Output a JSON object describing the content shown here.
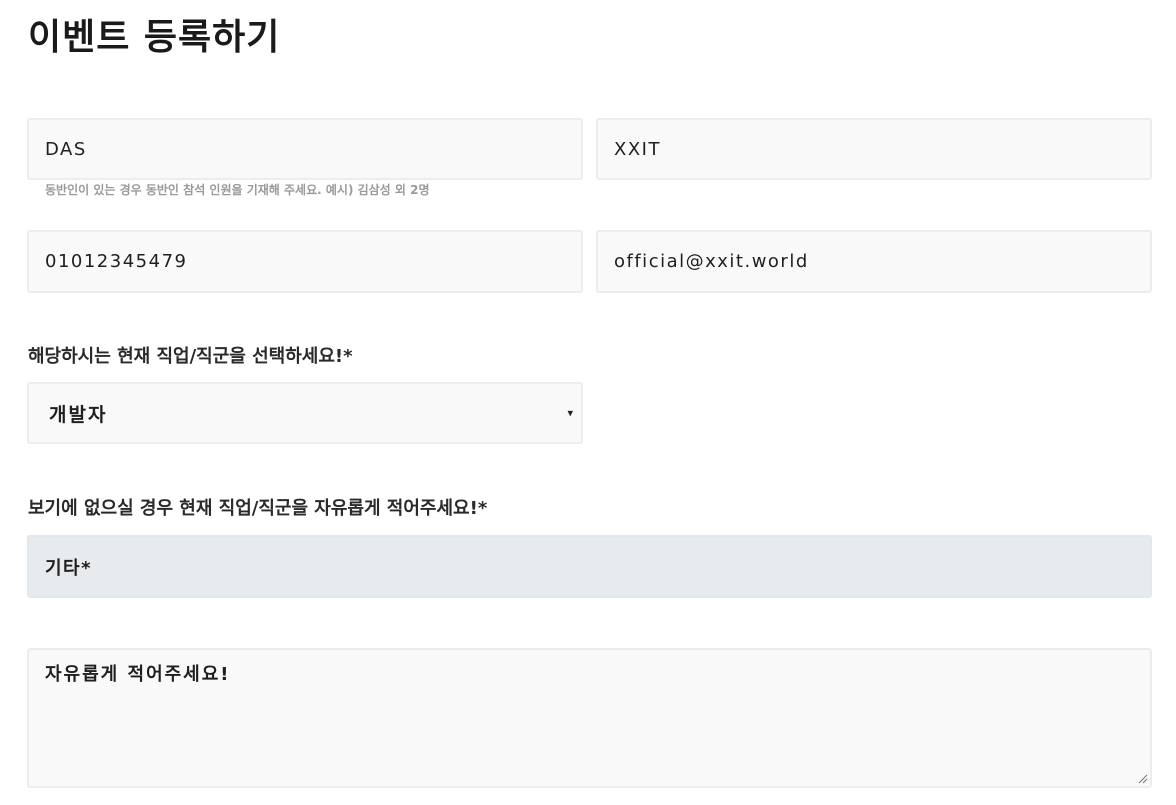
{
  "page": {
    "title": "이벤트 등록하기"
  },
  "form": {
    "first_name": {
      "value": "DAS"
    },
    "last_name": {
      "value": "XXIT"
    },
    "companion_hint": "동반인이 있는 경우 동반인 참석 인원을 기재해 주세요. 예시) 김삼성 외 2명",
    "phone": {
      "value": "01012345479"
    },
    "email": {
      "value": "official@xxit.world"
    },
    "job_select": {
      "label": "해당하시는 현재 직업/직군을 선택하세요!*",
      "selected": "개발자",
      "caret": "▾"
    },
    "job_other": {
      "label": "보기에 없으실 경우 현재 직업/직군을 자유롭게 적어주세요!*",
      "value": "기타*"
    },
    "free_text": {
      "placeholder": "자유롭게 적어주세요!"
    }
  },
  "colors": {
    "field_bg": "#f9f9f9",
    "field_border": "#ececec",
    "disabled_bg": "#e8ebee",
    "hint_text": "#9a9a9a"
  }
}
